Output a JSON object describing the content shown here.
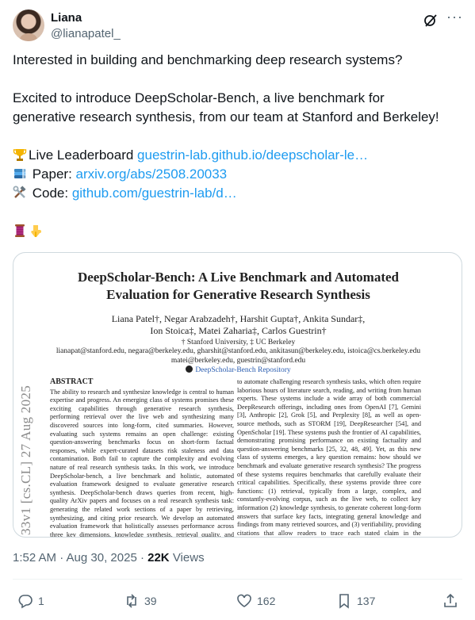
{
  "author": {
    "name": "Liana",
    "handle": "@lianapatel_"
  },
  "tweet": {
    "line1": "Interested in building and benchmarking deep research systems?",
    "line2": "Excited to introduce DeepScholar-Bench, a live benchmark for",
    "line3": "generative research synthesis, from our team at Stanford and Berkeley!",
    "leaderboard_label": "Live Leaderboard ",
    "leaderboard_link": "guestrin-lab.github.io/deepscholar-le…",
    "paper_label": " Paper: ",
    "paper_link": "arxiv.org/abs/2508.20033",
    "code_label": " Code: ",
    "code_link": "github.com/guestrin-lab/d…"
  },
  "paper": {
    "title_line1": "DeepScholar-Bench: A Live Benchmark and Automated",
    "title_line2": "Evaluation for Generative Research Synthesis",
    "authors_line1": "Liana Patel†, Negar Arabzadeh†, Harshit Gupta†, Ankita Sundar‡,",
    "authors_line2": "Ion Stoica‡, Matei Zaharia‡, Carlos Guestrin†",
    "affiliation": "† Stanford University, ‡ UC Berkeley",
    "emails_line1": "lianapat@stanford.edu, negara@berkeley.edu, gharshit@stanford.edu, ankitasun@berkeley.edu, istoica@cs.berkeley.edu",
    "emails_line2": "matei@berkeley.edu, guestrin@stanford.edu",
    "repo": "DeepScholar-Bench Repository",
    "arxiv_id": "33v1  [cs.CL]  27 Aug 2025",
    "abstract_heading": "ABSTRACT",
    "abstract_text": "The ability to research and synthesize knowledge is central to human expertise and progress. An emerging class of systems promises these exciting capabilities through generative research synthesis, performing retrieval over the live web and synthesizing many discovered sources into long-form, cited summaries. However, evaluating such systems remains an open challenge: existing question-answering benchmarks focus on short-form factual responses, while expert-curated datasets risk staleness and data contamination. Both fail to capture the complexity and evolving nature of real research synthesis tasks. In this work, we introduce DeepScholar-bench, a live benchmark and holistic, automated evaluation framework designed to evaluate generative research synthesis. DeepScholar-bench draws queries from recent, high-quality ArXiv papers and focuses on a real research synthesis task: generating the related work sections of a paper by retrieving, synthesizing, and citing prior research. We develop an automated evaluation framework that holistically assesses performance across three key dimensions, knowledge synthesis, retrieval quality, and verifiability, using met-",
    "right_text": "to automate challenging research synthesis tasks, which often require laborious hours of literature search, reading, and writing from human experts. These systems include a wide array of both commercial DeepResearch offerings, including ones from OpenAI [7], Gemini [3], Anthropic [2], Grok [5], and Perplexity [8], as well as open-source methods, such as STORM [19], DeepResearcher [54], and OpenScholar [19]. These systems push the frontier of AI capabilities, demonstrating promising performance on existing factuality and question-answering benchmarks [25, 32, 48, 49]. Yet, as this new class of systems emerges, a key question remains: how should we benchmark and evaluate generative research synthesis? The progress of these systems requires benchmarks that carefully evaluate their critical capabilities. Specifically, these systems provide three core functions: (1) retrieval, typically from a large, complex, and constantly-evolving corpus, such as the live web, to collect key information (2) knowledge synthesis, to generate coherent long-form answers that surface key facts, integrating general knowledge and findings from many retrieved sources, and (3) verifiability, providing citations that allow readers to trace each stated claim in the synthesized answer to a reputable source from"
  },
  "meta": {
    "time": "1:52 AM · Aug 30, 2025 · ",
    "views_count": "22K",
    "views_label": " Views"
  },
  "actions": {
    "replies": "1",
    "reposts": "39",
    "likes": "162",
    "bookmarks": "137"
  },
  "colors": {
    "link": "#1d9bf0",
    "muted": "#536471",
    "text": "#0f1419"
  }
}
